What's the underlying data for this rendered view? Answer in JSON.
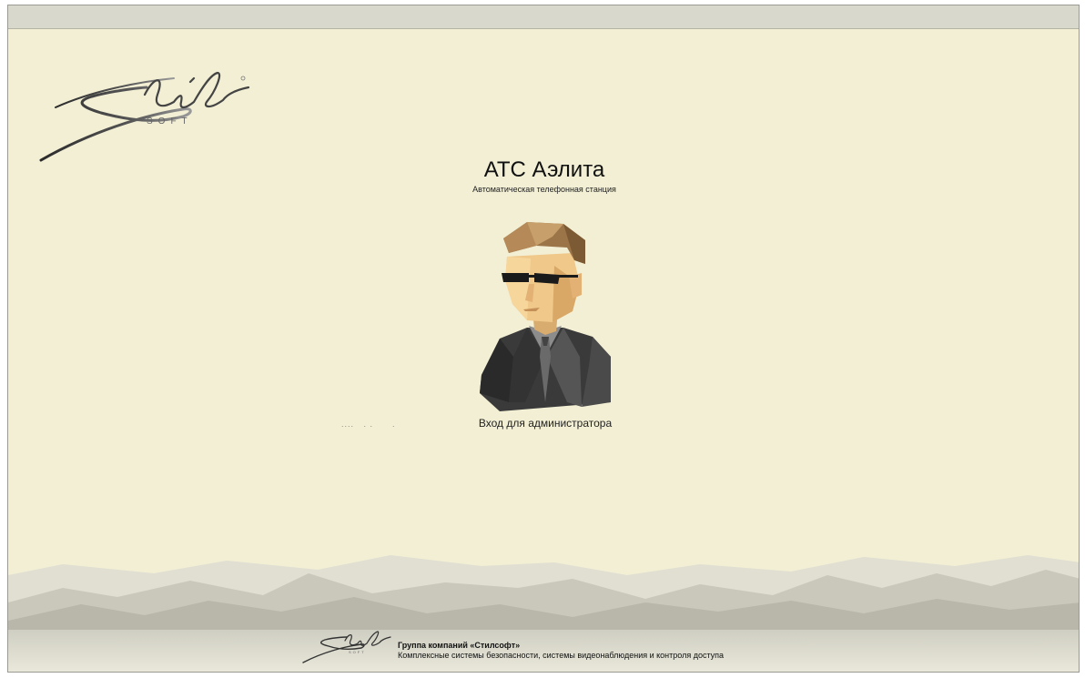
{
  "header": {
    "title": "АТС Аэлита",
    "subtitle": "Автоматическая телефонная станция"
  },
  "login": {
    "avatar_icon": "admin-avatar-icon",
    "label": "Вход для администратора"
  },
  "hint": {
    "dots": "....   . .      ."
  },
  "brand": {
    "logo_icon": "stilsoft-logo-icon",
    "company": "Группа компаний «Стилсофт»",
    "description": "Комплексные системы безопасности, системы видеонаблюдения и контроля доступа"
  },
  "colors": {
    "background": "#f2efd4",
    "topbar": "#d9d8cc",
    "mountains": "#c9c8bb"
  }
}
